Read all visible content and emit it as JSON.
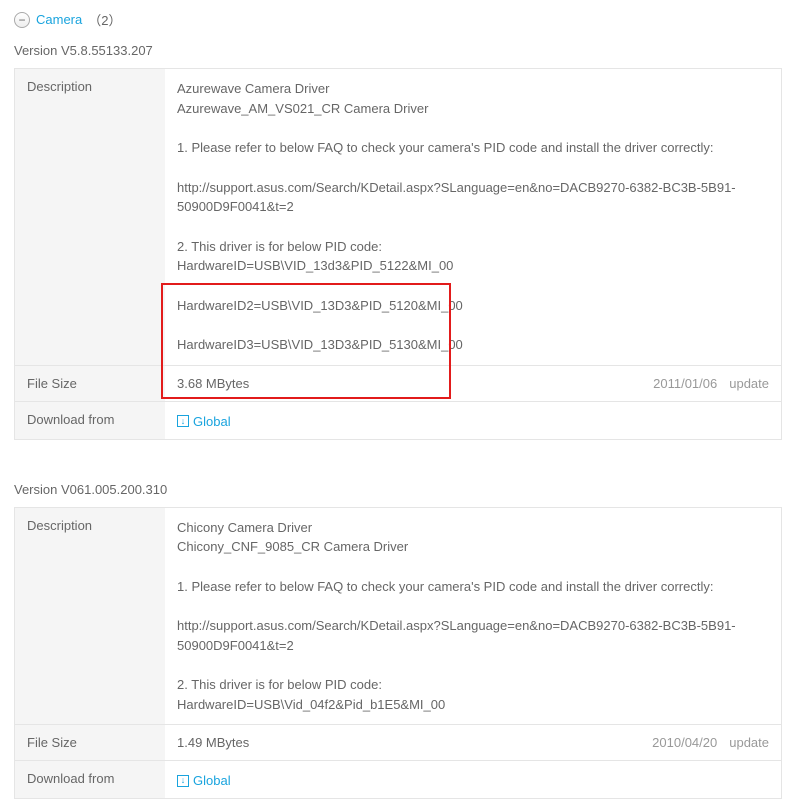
{
  "section": {
    "title": "Camera",
    "count": "（2）"
  },
  "labels": {
    "description": "Description",
    "filesize": "File Size",
    "download": "Download from",
    "update": "update"
  },
  "downloads": {
    "global": "Global"
  },
  "items": [
    {
      "version": "Version V5.8.55133.207",
      "desc": {
        "l1": "Azurewave Camera Driver",
        "l2": "Azurewave_AM_VS021_CR Camera Driver",
        "l3": "1. Please refer to below FAQ to check your camera's PID code and install the driver correctly:",
        "l4": "http://support.asus.com/Search/KDetail.aspx?SLanguage=en&no=DACB9270-6382-BC3B-5B91-50900D9F0041&t=2",
        "l5": "2. This driver is for below PID code:",
        "l6": "HardwareID=USB\\VID_13d3&PID_5122&MI_00",
        "l7": "HardwareID2=USB\\VID_13D3&PID_5120&MI_00",
        "l8": "HardwareID3=USB\\VID_13D3&PID_5130&MI_00"
      },
      "size": "3.68 MBytes",
      "date": "2011/01/06"
    },
    {
      "version": "Version V061.005.200.310",
      "desc": {
        "l1": "Chicony Camera Driver",
        "l2": "Chicony_CNF_9085_CR Camera Driver",
        "l3": "1. Please refer to below FAQ to check your camera's PID code and install the driver correctly:",
        "l4": "http://support.asus.com/Search/KDetail.aspx?SLanguage=en&no=DACB9270-6382-BC3B-5B91-50900D9F0041&t=2",
        "l5": "2. This driver is for below PID code:",
        "l6": "HardwareID=USB\\Vid_04f2&Pid_b1E5&MI_00"
      },
      "size": "1.49 MBytes",
      "date": "2010/04/20"
    }
  ]
}
